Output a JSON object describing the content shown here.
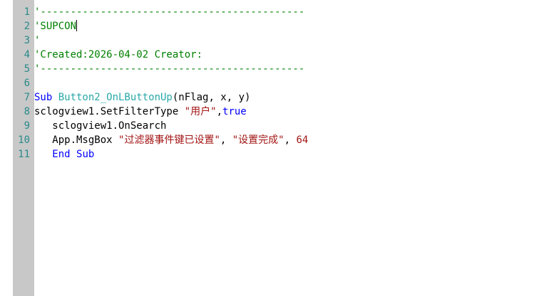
{
  "colors": {
    "gutter_bg": "#c8c8c8",
    "line_number": "#2b8a8a",
    "comment": "#008000",
    "keyword": "#0000ff",
    "function_name": "#2aa8a8",
    "string": "#a31515"
  },
  "editor": {
    "line_numbers": [
      "1",
      "2",
      "3",
      "4",
      "5",
      "6",
      "7",
      "8",
      "9",
      "10",
      "11"
    ],
    "lines": [
      {
        "tokens": [
          {
            "type": "comment",
            "text": "'--------------------------------------------"
          }
        ]
      },
      {
        "tokens": [
          {
            "type": "comment",
            "text": "'SUPCON"
          },
          {
            "type": "caret",
            "text": ""
          }
        ]
      },
      {
        "tokens": [
          {
            "type": "comment",
            "text": "'"
          }
        ]
      },
      {
        "tokens": [
          {
            "type": "comment",
            "text": "'Created:2026-04-02 Creator:"
          }
        ]
      },
      {
        "tokens": [
          {
            "type": "comment",
            "text": "'--------------------------------------------"
          }
        ]
      },
      {
        "tokens": []
      },
      {
        "tokens": [
          {
            "type": "keyword",
            "text": "Sub "
          },
          {
            "type": "func",
            "text": "Button2_OnLButtonUp"
          },
          {
            "type": "plain",
            "text": "(nFlag, x, y)"
          }
        ]
      },
      {
        "tokens": [
          {
            "type": "plain",
            "text": "sclogview1.SetFilterType "
          },
          {
            "type": "string",
            "text": "\"用户\""
          },
          {
            "type": "plain",
            "text": ","
          },
          {
            "type": "keyword",
            "text": "true"
          }
        ]
      },
      {
        "tokens": [
          {
            "type": "plain",
            "text": "   sclogview1.OnSearch"
          }
        ]
      },
      {
        "tokens": [
          {
            "type": "plain",
            "text": "   App.MsgBox "
          },
          {
            "type": "string",
            "text": "\"过滤器事件键已设置\""
          },
          {
            "type": "plain",
            "text": ", "
          },
          {
            "type": "string",
            "text": "\"设置完成\""
          },
          {
            "type": "plain",
            "text": ", "
          },
          {
            "type": "number",
            "text": "64"
          }
        ]
      },
      {
        "tokens": [
          {
            "type": "plain",
            "text": "   "
          },
          {
            "type": "keyword",
            "text": "End Sub"
          }
        ]
      }
    ]
  }
}
